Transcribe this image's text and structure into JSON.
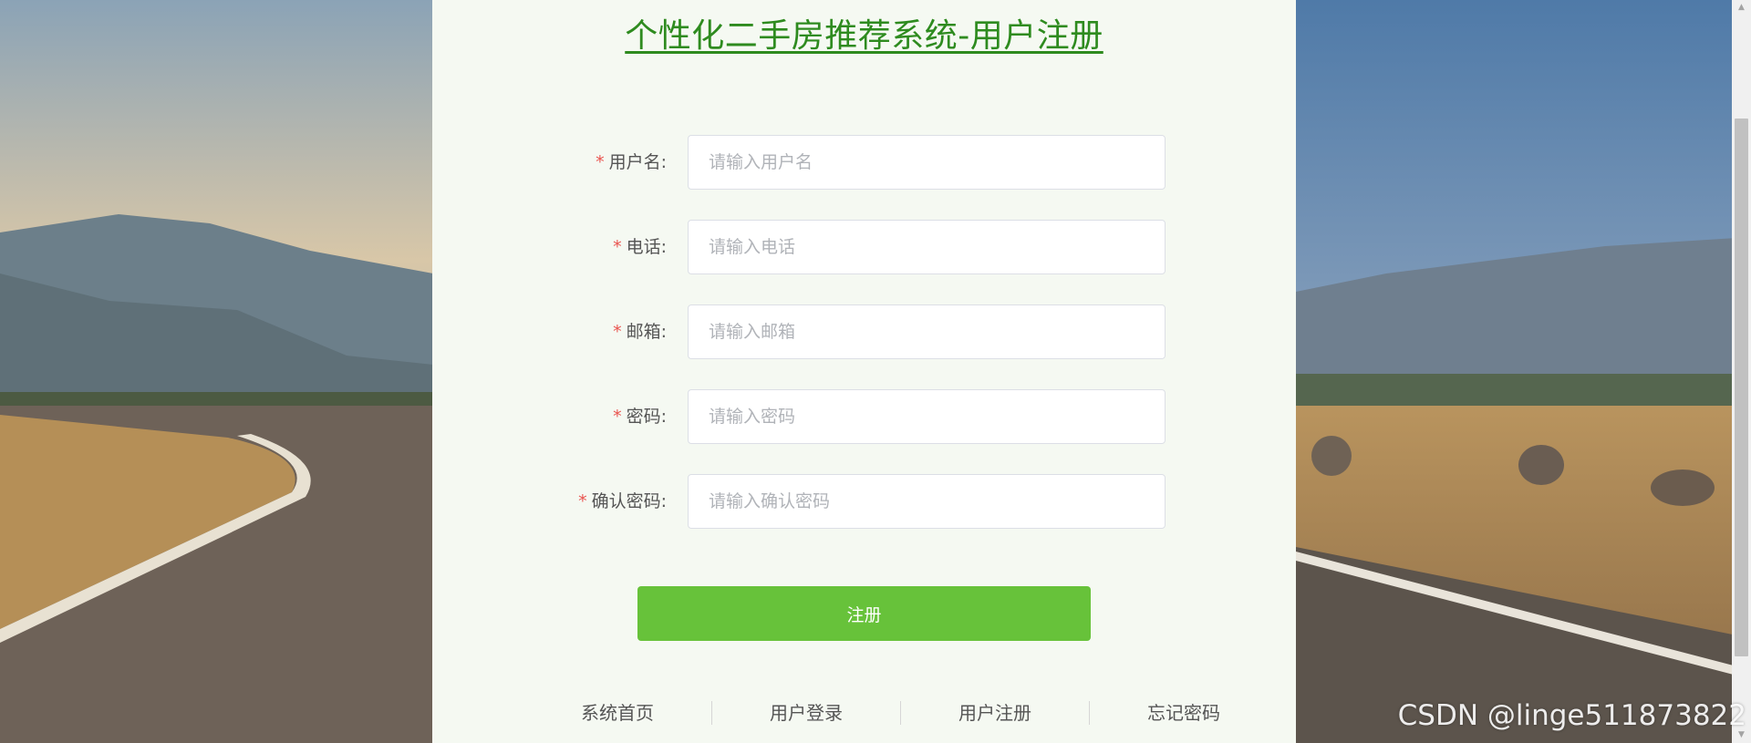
{
  "page": {
    "title": "个性化二手房推荐系统-用户注册"
  },
  "form": {
    "required_mark": "*",
    "fields": [
      {
        "label": "用户名:",
        "placeholder": "请输入用户名",
        "value": ""
      },
      {
        "label": "电话:",
        "placeholder": "请输入电话",
        "value": ""
      },
      {
        "label": "邮箱:",
        "placeholder": "请输入邮箱",
        "value": ""
      },
      {
        "label": "密码:",
        "placeholder": "请输入密码",
        "value": ""
      },
      {
        "label": "确认密码:",
        "placeholder": "请输入确认密码",
        "value": ""
      }
    ],
    "submit_label": "注册"
  },
  "footer": {
    "links": [
      "系统首页",
      "用户登录",
      "用户注册",
      "忘记密码"
    ]
  },
  "watermark": "CSDN @linge511873822",
  "colors": {
    "title": "#2e8b1f",
    "primary_button": "#67c23a",
    "required": "#e9544f",
    "panel_bg": "#f5f9f2"
  },
  "icons": {
    "scroll_up": "triangle-up",
    "scroll_down": "triangle-down"
  }
}
